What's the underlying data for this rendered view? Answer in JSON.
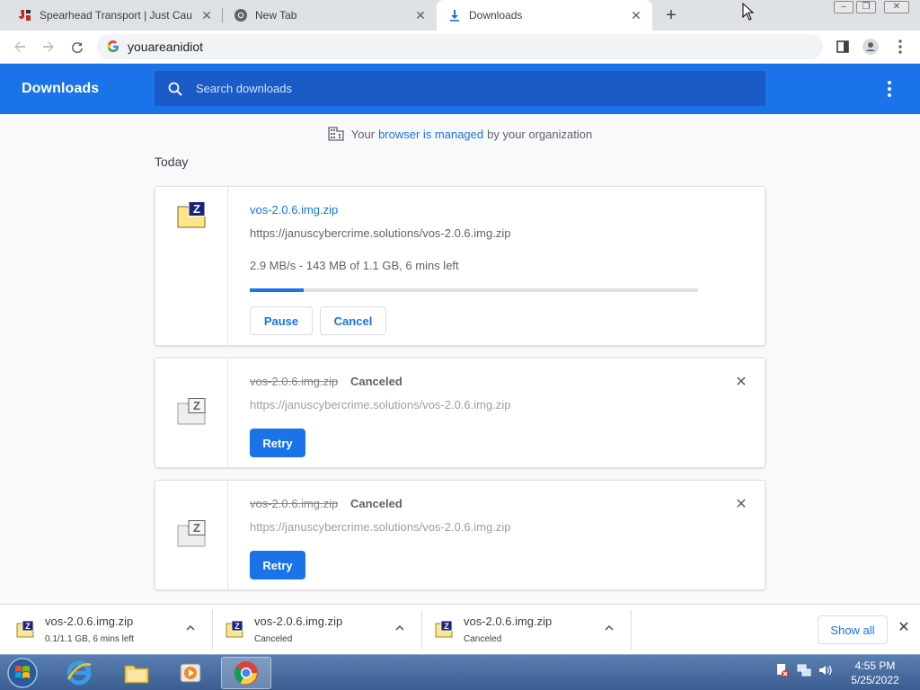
{
  "browser": {
    "tabs": [
      {
        "title": "Spearhead Transport | Just Cause"
      },
      {
        "title": "New Tab"
      },
      {
        "title": "Downloads"
      }
    ],
    "address": "youareanidiot"
  },
  "header": {
    "title": "Downloads",
    "search_placeholder": "Search downloads"
  },
  "managed_notice": {
    "prefix": "Your",
    "link": "browser is managed",
    "suffix": "by your organization"
  },
  "section_label": "Today",
  "downloads": [
    {
      "filename": "vos-2.0.6.img.zip",
      "url": "https://januscybercrime.solutions/vos-2.0.6.img.zip",
      "progress_text": "2.9 MB/s - 143 MB of 1.1 GB, 6 mins left",
      "progress_fraction": 0.12,
      "pause_label": "Pause",
      "cancel_label": "Cancel"
    },
    {
      "filename": "vos-2.0.6.img.zip",
      "status": "Canceled",
      "url": "https://januscybercrime.solutions/vos-2.0.6.img.zip",
      "retry_label": "Retry"
    },
    {
      "filename": "vos-2.0.6.img.zip",
      "status": "Canceled",
      "url": "https://januscybercrime.solutions/vos-2.0.6.img.zip",
      "retry_label": "Retry"
    }
  ],
  "shelf": {
    "items": [
      {
        "name": "vos-2.0.6.img.zip",
        "sub": "0.1/1.1 GB, 6 mins left"
      },
      {
        "name": "vos-2.0.6.img.zip",
        "sub": "Canceled"
      },
      {
        "name": "vos-2.0.6.img.zip",
        "sub": "Canceled"
      }
    ],
    "show_all_label": "Show all"
  },
  "taskbar": {
    "time": "4:55 PM",
    "date": "5/25/2022"
  },
  "colors": {
    "accent": "#1a73e8",
    "header_bg": "#1a73e8",
    "search_bg": "#1a5bc7"
  }
}
